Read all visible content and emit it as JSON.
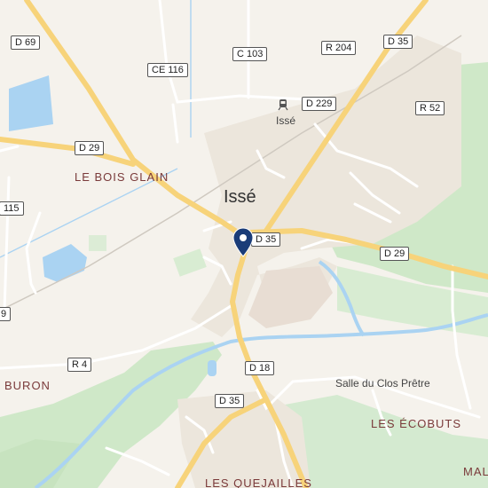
{
  "map": {
    "town_label": "Issé",
    "station_label": "Issé",
    "poi_label": "Salle du Clos Prêtre",
    "places": {
      "le_bois_glain": "LE BOIS GLAIN",
      "buron": "BURON",
      "les_ecobuts": "LES ÉCOBUTS",
      "les_quejailles": "LES QUEJAILLES",
      "mal": "MAL"
    },
    "roads": {
      "d69": "D 69",
      "c103": "C 103",
      "r204": "R 204",
      "d35_top": "D 35",
      "ce116": "CE 116",
      "d229": "D 229",
      "r52": "R 52",
      "d29_west": "D 29",
      "d115": "115",
      "d35_center": "D 35",
      "d29_east": "D 29",
      "d9_edge": "9",
      "r4": "R 4",
      "d18": "D 18",
      "d35_south": "D 35"
    },
    "icons": {
      "marker": "map-pin-icon",
      "station": "train-station-icon"
    },
    "colors": {
      "land": "#f5f2ec",
      "water": "#aad3f2",
      "forest": "#cfe8c8",
      "major_road": "#f7d37a",
      "minor_road": "#ffffff",
      "marker": "#1a3c78"
    }
  }
}
